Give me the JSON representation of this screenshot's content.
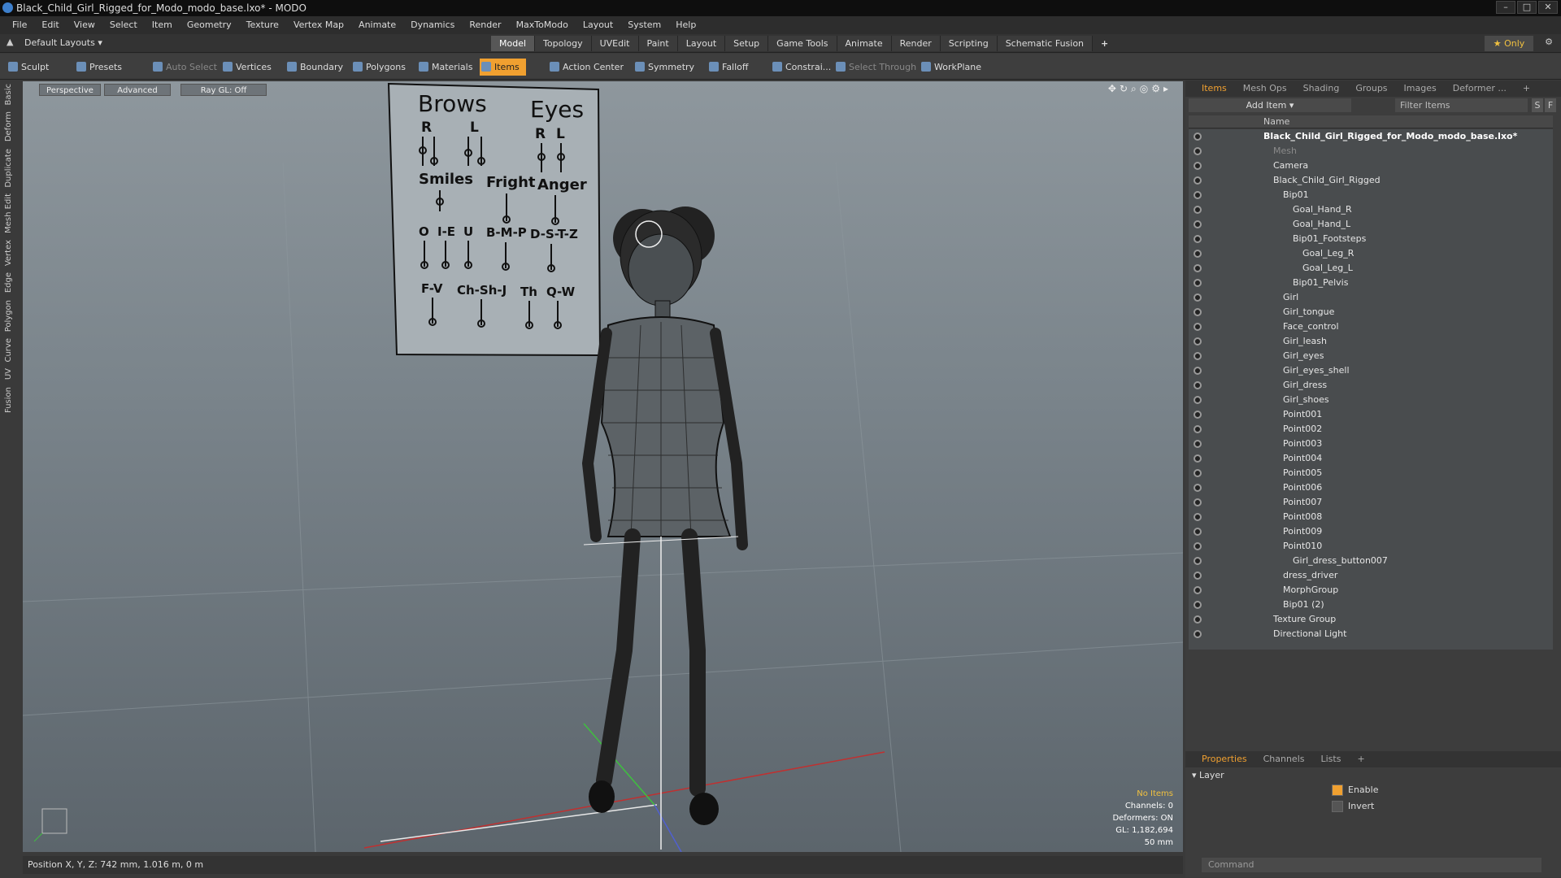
{
  "window": {
    "title": "Black_Child_Girl_Rigged_for_Modo_modo_base.lxo* - MODO"
  },
  "menu": [
    "File",
    "Edit",
    "View",
    "Select",
    "Item",
    "Geometry",
    "Texture",
    "Vertex Map",
    "Animate",
    "Dynamics",
    "Render",
    "MaxToModo",
    "Layout",
    "System",
    "Help"
  ],
  "layout": {
    "default_layouts": "Default Layouts",
    "tabs": [
      "Model",
      "Topology",
      "UVEdit",
      "Paint",
      "Layout",
      "Setup",
      "Game Tools",
      "Animate",
      "Render",
      "Scripting",
      "Schematic Fusion"
    ],
    "active_tab": "Model",
    "only": "Only"
  },
  "toolbar": {
    "sculpt": "Sculpt",
    "presets": "Presets",
    "auto_select": "Auto Select",
    "vertices": "Vertices",
    "boundary": "Boundary",
    "polygons": "Polygons",
    "materials": "Materials",
    "items": "Items",
    "action_center": "Action Center",
    "symmetry": "Symmetry",
    "falloff": "Falloff",
    "constraints": "Constrai...",
    "select_through": "Select Through",
    "workplane": "WorkPlane"
  },
  "left_tabs": [
    "Basic",
    "Deform",
    "Duplicate",
    "Mesh Edit",
    "Vertex",
    "Edge",
    "Polygon",
    "Curve",
    "UV",
    "Fusion"
  ],
  "viewport": {
    "perspective": "Perspective",
    "advanced": "Advanced",
    "raygl": "Ray GL: Off",
    "info": {
      "no_items": "No Items",
      "channels": "Channels: 0",
      "deformers": "Deformers: ON",
      "gl": "GL: 1,182,694",
      "scale": "50 mm"
    },
    "face_board": {
      "brows": "Brows",
      "eyes": "Eyes",
      "r": "R",
      "l": "L",
      "smiles": "Smiles",
      "fright": "Fright",
      "anger": "Anger",
      "o": "O",
      "ie": "I-E",
      "u": "U",
      "bmp": "B-M-P",
      "dstz": "D-S-T-Z",
      "fv": "F-V",
      "chshj": "Ch-Sh-J",
      "th": "Th",
      "qw": "Q-W"
    }
  },
  "status": {
    "position": "Position X, Y, Z:  742 mm, 1.016 m, 0 m"
  },
  "items_panel": {
    "tabs": [
      "Items",
      "Mesh Ops",
      "Shading",
      "Groups",
      "Images",
      "Deformer ..."
    ],
    "add_item": "Add Item",
    "filter": "Filter Items",
    "name_col": "Name",
    "tree": [
      {
        "label": "Black_Child_Girl_Rigged_for_Modo_modo_base.lxo*",
        "indent": 0,
        "bold": true
      },
      {
        "label": "Mesh",
        "indent": 1,
        "dim": true
      },
      {
        "label": "Camera",
        "indent": 1
      },
      {
        "label": "Black_Child_Girl_Rigged",
        "indent": 1
      },
      {
        "label": "Bip01",
        "indent": 2
      },
      {
        "label": "Goal_Hand_R",
        "indent": 3
      },
      {
        "label": "Goal_Hand_L",
        "indent": 3
      },
      {
        "label": "Bip01_Footsteps",
        "indent": 3
      },
      {
        "label": "Goal_Leg_R",
        "indent": 4
      },
      {
        "label": "Goal_Leg_L",
        "indent": 4
      },
      {
        "label": "Bip01_Pelvis",
        "indent": 3
      },
      {
        "label": "Girl",
        "indent": 2
      },
      {
        "label": "Girl_tongue",
        "indent": 2
      },
      {
        "label": "Face_control",
        "indent": 2
      },
      {
        "label": "Girl_leash",
        "indent": 2
      },
      {
        "label": "Girl_eyes",
        "indent": 2
      },
      {
        "label": "Girl_eyes_shell",
        "indent": 2
      },
      {
        "label": "Girl_dress",
        "indent": 2
      },
      {
        "label": "Girl_shoes",
        "indent": 2
      },
      {
        "label": "Point001",
        "indent": 2
      },
      {
        "label": "Point002",
        "indent": 2
      },
      {
        "label": "Point003",
        "indent": 2
      },
      {
        "label": "Point004",
        "indent": 2
      },
      {
        "label": "Point005",
        "indent": 2
      },
      {
        "label": "Point006",
        "indent": 2
      },
      {
        "label": "Point007",
        "indent": 2
      },
      {
        "label": "Point008",
        "indent": 2
      },
      {
        "label": "Point009",
        "indent": 2
      },
      {
        "label": "Point010",
        "indent": 2
      },
      {
        "label": "Girl_dress_button007",
        "indent": 3
      },
      {
        "label": "dress_driver",
        "indent": 2
      },
      {
        "label": "MorphGroup",
        "indent": 2
      },
      {
        "label": "Bip01 (2)",
        "indent": 2
      },
      {
        "label": "Texture Group",
        "indent": 1
      },
      {
        "label": "Directional Light",
        "indent": 1
      }
    ]
  },
  "properties": {
    "tabs": [
      "Properties",
      "Channels",
      "Lists"
    ],
    "layer": "Layer",
    "enable": "Enable",
    "invert": "Invert",
    "command": "Command"
  }
}
